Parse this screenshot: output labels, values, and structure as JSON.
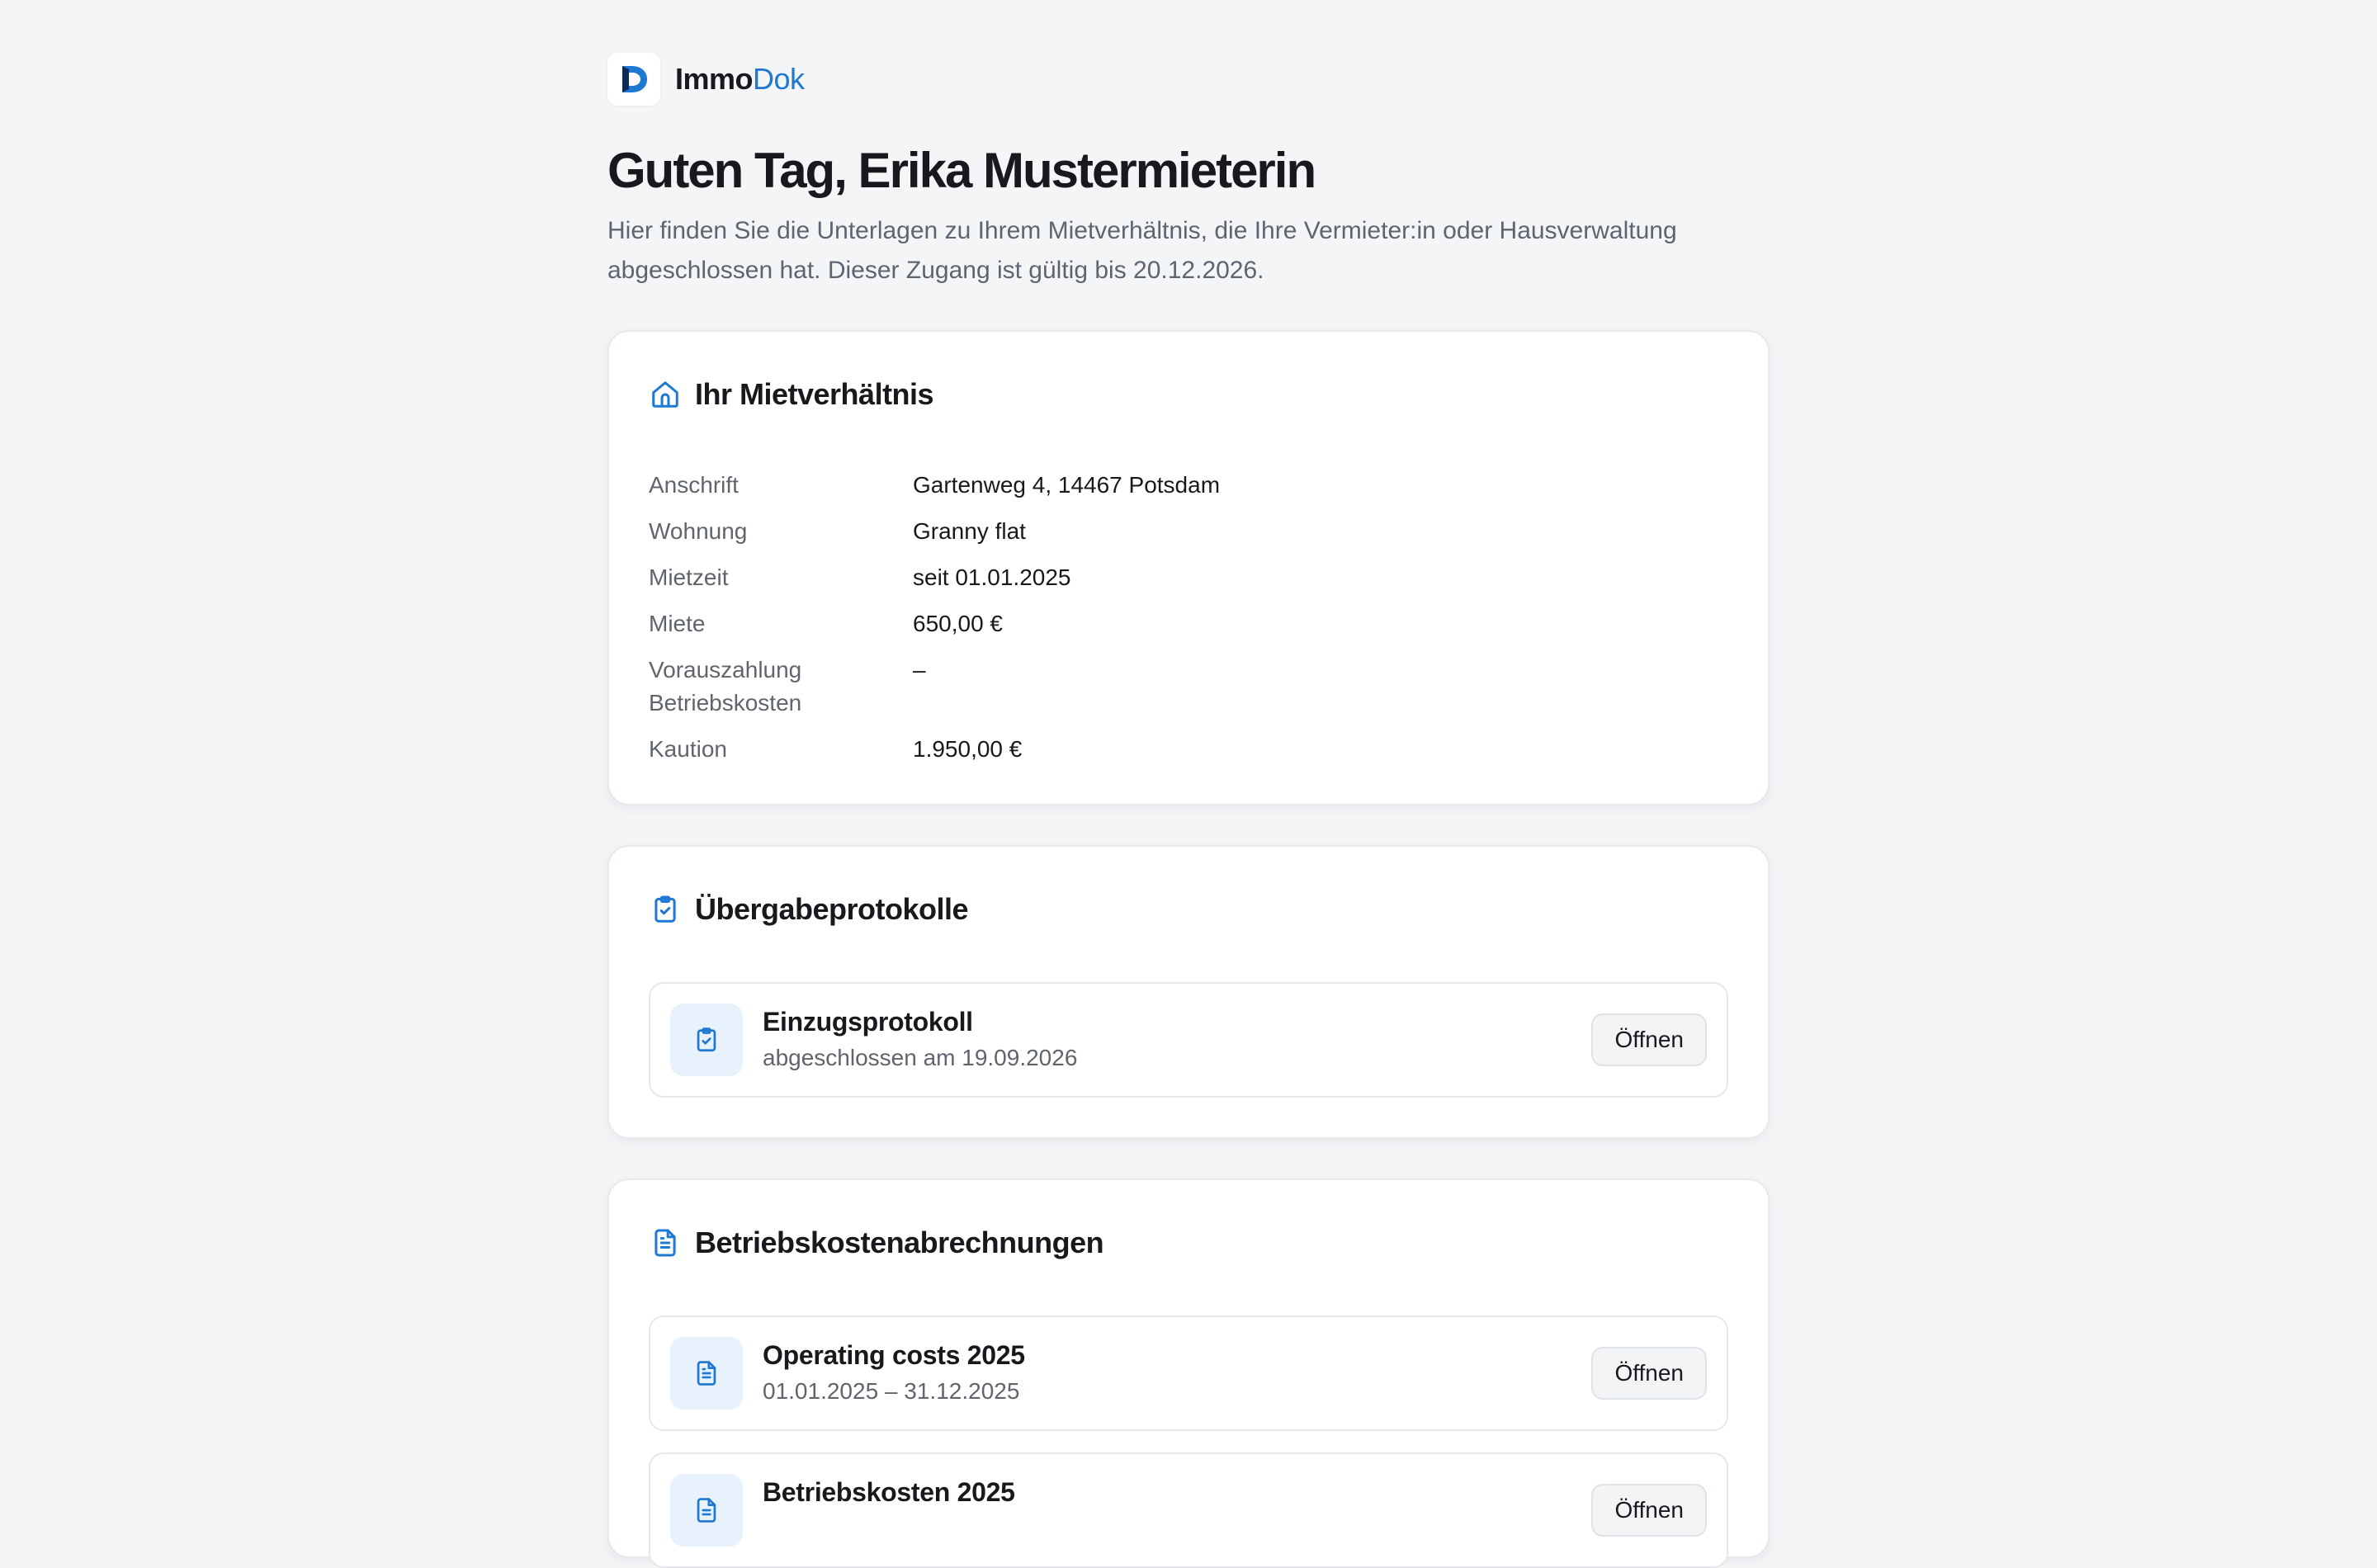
{
  "brand": {
    "name_primary": "Immo",
    "name_accent": "Dok",
    "logo_icon": "immodok-logo-icon"
  },
  "header": {
    "greeting": "Guten Tag, Erika Mustermieterin",
    "intro": "Hier finden Sie die Unterlagen zu Ihrem Mietverhältnis, die Ihre Vermieter:in oder Hausverwaltung abgeschlossen hat. Dieser Zugang ist gültig bis 20.12.2026."
  },
  "tenancy": {
    "title": "Ihr Mietverhältnis",
    "icon": "home-icon",
    "rows": [
      {
        "label": "Anschrift",
        "value": "Gartenweg 4, 14467 Potsdam"
      },
      {
        "label": "Wohnung",
        "value": "Granny flat"
      },
      {
        "label": "Mietzeit",
        "value": "seit 01.01.2025"
      },
      {
        "label": "Miete",
        "value": "650,00 €"
      },
      {
        "label": "Vorauszahlung Betriebskosten",
        "value": "–"
      },
      {
        "label": "Kaution",
        "value": "1.950,00 €"
      }
    ]
  },
  "handover": {
    "title": "Übergabeprotokolle",
    "icon": "clipboard-check-icon",
    "items": [
      {
        "title": "Einzugsprotokoll",
        "subtitle": "abgeschlossen am 19.09.2026",
        "button": "Öffnen"
      }
    ]
  },
  "statements": {
    "title": "Betriebskostenabrechnungen",
    "icon": "document-icon",
    "items": [
      {
        "title": "Operating costs 2025",
        "subtitle": "01.01.2025 – 31.12.2025",
        "button": "Öffnen"
      },
      {
        "title": "Betriebskosten 2025",
        "subtitle": "",
        "button": "Öffnen"
      }
    ]
  },
  "colors": {
    "accent": "#1f78d1",
    "background": "#f4f5f7",
    "icon_tile": "#e8f2fc"
  }
}
